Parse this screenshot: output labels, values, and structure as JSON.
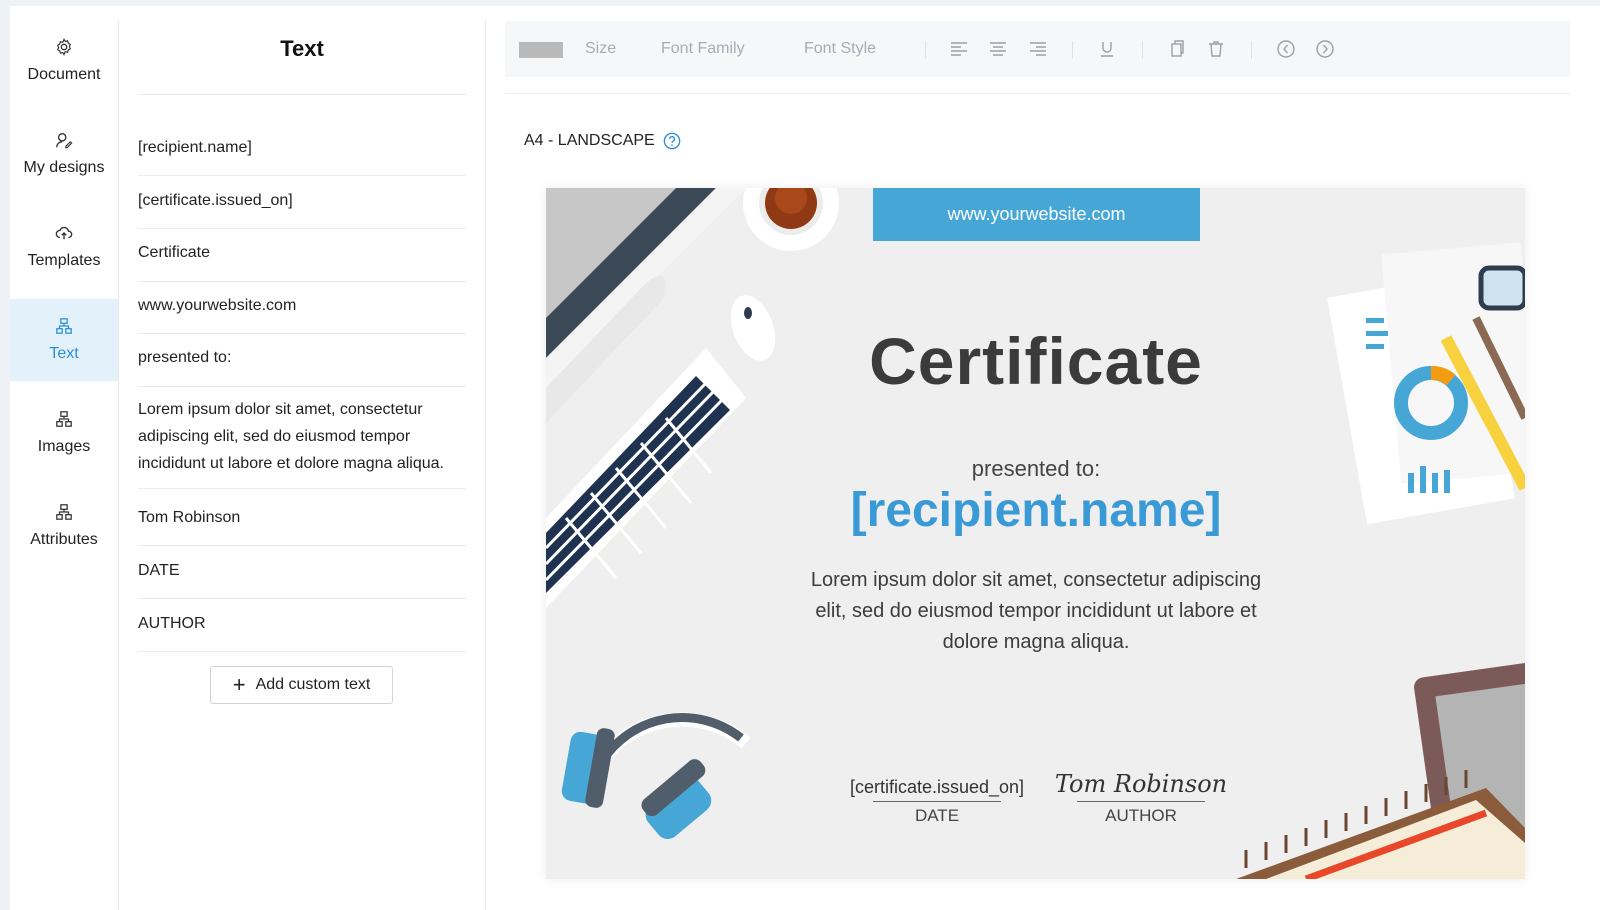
{
  "nav": {
    "items": [
      {
        "label": "Document",
        "icon": "gear-icon"
      },
      {
        "label": "My designs",
        "icon": "user-edit-icon"
      },
      {
        "label": "Templates",
        "icon": "cloud-upload-icon"
      },
      {
        "label": "Text",
        "icon": "sitemap-icon",
        "active": true
      },
      {
        "label": "Images",
        "icon": "sitemap-icon"
      },
      {
        "label": "Attributes",
        "icon": "sitemap-icon"
      }
    ],
    "active_color": "#2b8fd6"
  },
  "panel": {
    "title": "Text",
    "items": [
      "[recipient.name]",
      "[certificate.issued_on]",
      "Certificate",
      "www.yourwebsite.com",
      "presented to:",
      "Lorem ipsum dolor sit amet, consectetur adipiscing elit, sed do eiusmod tempor incididunt ut labore et dolore magna aliqua.",
      "Tom Robinson",
      "DATE",
      "AUTHOR"
    ],
    "add_button": "Add custom text"
  },
  "toolbar": {
    "size_label": "Size",
    "font_family_label": "Font Family",
    "font_style_label": "Font Style",
    "swatch_color": "#b9b9b9"
  },
  "canvas": {
    "paper": "A4 - LANDSCAPE"
  },
  "certificate": {
    "website": "www.yourwebsite.com",
    "title": "Certificate",
    "presented": "presented to:",
    "recipient": "[recipient.name]",
    "body": "Lorem ipsum dolor sit amet, consectetur adipiscing elit, sed do eiusmod tempor incididunt ut labore et dolore magna aliqua.",
    "date_value": "[certificate.issued_on]",
    "date_label": "DATE",
    "author_signature": "Tom Robinson",
    "author_label": "AUTHOR",
    "accent_color": "#46a7d7"
  }
}
